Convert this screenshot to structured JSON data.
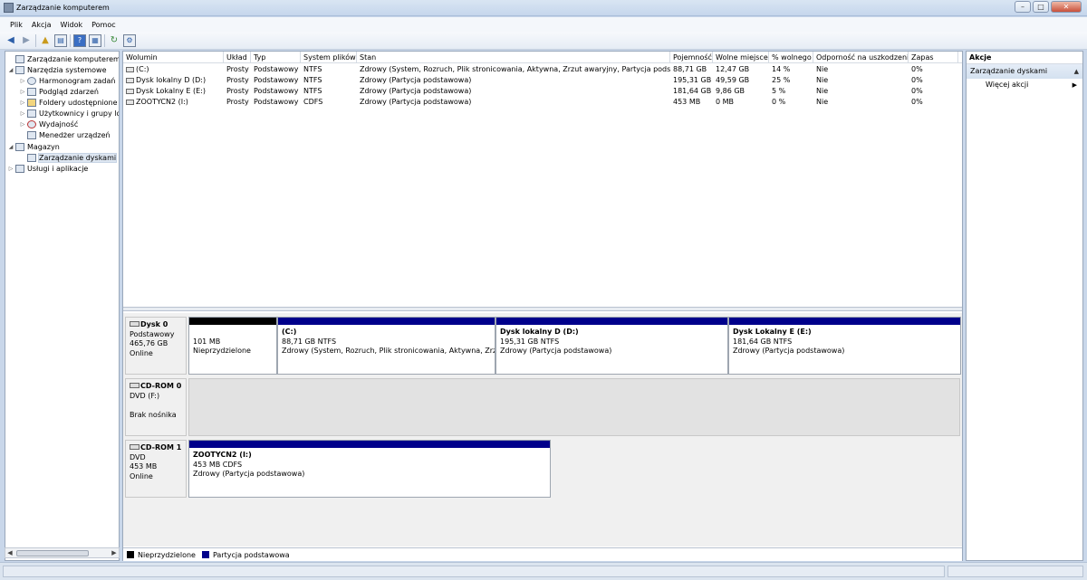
{
  "window": {
    "title": "Zarządzanie komputerem",
    "controls": [
      "–",
      "□",
      "✕"
    ]
  },
  "menu": [
    "Plik",
    "Akcja",
    "Widok",
    "Pomoc"
  ],
  "toolbar": {
    "icons": [
      "back-icon",
      "forward-icon",
      "up-folder-icon",
      "show-hide-tree-icon",
      "help-icon",
      "properties-icon",
      "refresh-icon",
      "settings-icon"
    ]
  },
  "tree": [
    {
      "label": "Zarządzanie komputerem (loka",
      "level": 0,
      "arrow": "",
      "icon": "computer-management-icon"
    },
    {
      "label": "Narzędzia systemowe",
      "level": 1,
      "arrow": "◢",
      "icon": "system-tools-icon"
    },
    {
      "label": "Harmonogram zadań",
      "level": 2,
      "arrow": "▷",
      "icon": "task-scheduler-icon"
    },
    {
      "label": "Podgląd zdarzeń",
      "level": 2,
      "arrow": "▷",
      "icon": "event-viewer-icon"
    },
    {
      "label": "Foldery udostępnione",
      "level": 2,
      "arrow": "▷",
      "icon": "shared-folders-icon"
    },
    {
      "label": "Użytkownicy i grupy lok",
      "level": 2,
      "arrow": "▷",
      "icon": "users-groups-icon"
    },
    {
      "label": "Wydajność",
      "level": 2,
      "arrow": "▷",
      "icon": "performance-icon"
    },
    {
      "label": "Menedżer urządzeń",
      "level": 2,
      "arrow": "",
      "icon": "device-manager-icon"
    },
    {
      "label": "Magazyn",
      "level": 1,
      "arrow": "◢",
      "icon": "storage-icon"
    },
    {
      "label": "Zarządzanie dyskami",
      "level": 2,
      "arrow": "",
      "icon": "disk-management-icon",
      "selected": true
    },
    {
      "label": "Usługi i aplikacje",
      "level": 1,
      "arrow": "▷",
      "icon": "services-apps-icon"
    }
  ],
  "volumes": {
    "columns": [
      "Wolumin",
      "Układ",
      "Typ",
      "System plików",
      "Stan",
      "Pojemność",
      "Wolne miejsce",
      "% wolnego",
      "Odporność na uszkodzenia",
      "Zapas"
    ],
    "rows": [
      [
        "(C:)",
        "Prosty",
        "Podstawowy",
        "NTFS",
        "Zdrowy (System, Rozruch, Plik stronicowania, Aktywna, Zrzut awaryjny, Partycja podstawowa)",
        "88,71 GB",
        "12,47 GB",
        "14 %",
        "Nie",
        "0%"
      ],
      [
        "Dysk lokalny D (D:)",
        "Prosty",
        "Podstawowy",
        "NTFS",
        "Zdrowy (Partycja podstawowa)",
        "195,31 GB",
        "49,59 GB",
        "25 %",
        "Nie",
        "0%"
      ],
      [
        "Dysk Lokalny E (E:)",
        "Prosty",
        "Podstawowy",
        "NTFS",
        "Zdrowy (Partycja podstawowa)",
        "181,64 GB",
        "9,86 GB",
        "5 %",
        "Nie",
        "0%"
      ],
      [
        "ZOOTYCN2 (I:)",
        "Prosty",
        "Podstawowy",
        "CDFS",
        "Zdrowy (Partycja podstawowa)",
        "453 MB",
        "0 MB",
        "0 %",
        "Nie",
        "0%"
      ]
    ]
  },
  "disks": {
    "disk0": {
      "name": "Dysk 0",
      "type": "Podstawowy",
      "size": "465,76 GB",
      "status": "Online",
      "partitions": [
        {
          "name": "",
          "size": "101 MB",
          "state": "Nieprzydzielone",
          "kind": "unallocated"
        },
        {
          "name": "(C:)",
          "size": "88,71 GB NTFS",
          "state": "Zdrowy (System, Rozruch, Plik stronicowania, Aktywna, Zrzut aw",
          "kind": "primary"
        },
        {
          "name": "Dysk lokalny D  (D:)",
          "size": "195,31 GB NTFS",
          "state": "Zdrowy (Partycja podstawowa)",
          "kind": "primary"
        },
        {
          "name": "Dysk Lokalny E  (E:)",
          "size": "181,64 GB NTFS",
          "state": "Zdrowy (Partycja podstawowa)",
          "kind": "primary"
        }
      ]
    },
    "cdrom0": {
      "name": "CD-ROM 0",
      "type": "DVD (F:)",
      "status": "Brak nośnika"
    },
    "cdrom1": {
      "name": "CD-ROM 1",
      "type": "DVD",
      "size": "453 MB",
      "status": "Online",
      "partitions": [
        {
          "name": "ZOOTYCN2  (I:)",
          "size": "453 MB CDFS",
          "state": "Zdrowy (Partycja podstawowa)",
          "kind": "primary"
        }
      ]
    }
  },
  "legend": [
    {
      "label": "Nieprzydzielone",
      "color": "#000000"
    },
    {
      "label": "Partycja podstawowa",
      "color": "#00008b"
    }
  ],
  "actions": {
    "header": "Akcje",
    "section": "Zarządzanie dyskami",
    "items": [
      "Więcej akcji"
    ]
  },
  "colors": {
    "unallocated": "#000000",
    "primary": "#00008b"
  }
}
